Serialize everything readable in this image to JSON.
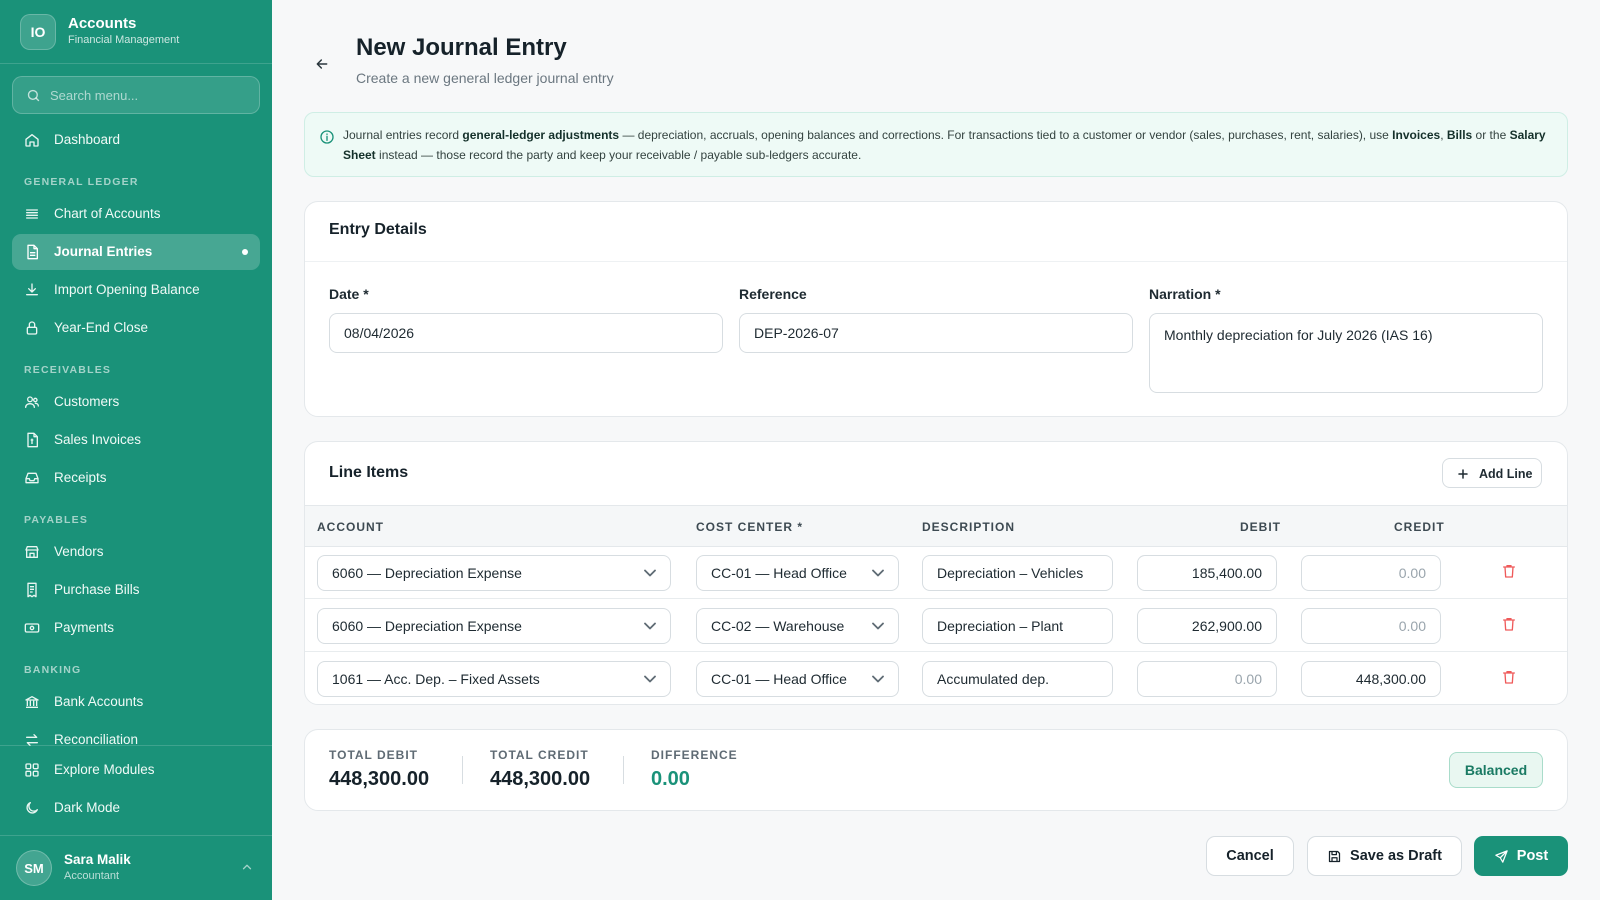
{
  "sidebar": {
    "logo_initials": "IO",
    "app_title": "Accounts",
    "app_subtitle": "Financial Management",
    "search_placeholder": "Search menu...",
    "dashboard": "Dashboard",
    "sections": {
      "general_ledger": "GENERAL LEDGER",
      "receivables": "RECEIVABLES",
      "payables": "PAYABLES",
      "banking": "BANKING"
    },
    "items": {
      "chart_of_accounts": "Chart of Accounts",
      "journal_entries": "Journal Entries",
      "import_opening_balance": "Import Opening Balance",
      "year_end_close": "Year-End Close",
      "customers": "Customers",
      "sales_invoices": "Sales Invoices",
      "receipts": "Receipts",
      "vendors": "Vendors",
      "purchase_bills": "Purchase Bills",
      "payments": "Payments",
      "bank_accounts": "Bank Accounts",
      "reconciliation": "Reconciliation"
    },
    "explore_modules": "Explore Modules",
    "dark_mode": "Dark Mode",
    "user": {
      "initials": "SM",
      "name": "Sara Malik",
      "role": "Accountant"
    }
  },
  "header": {
    "title": "New Journal Entry",
    "subtitle": "Create a new general ledger journal entry"
  },
  "info": {
    "t1": "Journal entries record ",
    "b1": "general-ledger adjustments",
    "t2": " — depreciation, accruals, opening balances and corrections. For transactions tied to a customer or vendor (sales, purchases, rent, salaries), use ",
    "b2": "Invoices",
    "t3": ", ",
    "b3": "Bills",
    "t4": " or the ",
    "b4": "Salary Sheet",
    "t5": " instead — those record the party and keep your receivable / payable sub-ledgers accurate."
  },
  "entry": {
    "title": "Entry Details",
    "date_label": "Date *",
    "date_value": "08/04/2026",
    "reference_label": "Reference",
    "reference_value": "DEP-2026-07",
    "narration_label": "Narration *",
    "narration_value": "Monthly depreciation for July 2026 (IAS 16)"
  },
  "lines": {
    "title": "Line Items",
    "add_line": "Add Line",
    "headers": {
      "account": "ACCOUNT",
      "cost_center": "COST CENTER *",
      "description": "DESCRIPTION",
      "debit": "DEBIT",
      "credit": "CREDIT"
    },
    "rows": [
      {
        "account": "6060 — Depreciation Expense",
        "cost_center": "CC-01 — Head Office",
        "description": "Depreciation – Vehicles",
        "debit": "185,400.00",
        "credit": "0.00"
      },
      {
        "account": "6060 — Depreciation Expense",
        "cost_center": "CC-02 — Warehouse",
        "description": "Depreciation – Plant",
        "debit": "262,900.00",
        "credit": "0.00"
      },
      {
        "account": "1061 — Acc. Dep. – Fixed Assets",
        "cost_center": "CC-01 — Head Office",
        "description": "Accumulated dep.",
        "debit": "0.00",
        "credit": "448,300.00"
      }
    ]
  },
  "totals": {
    "debit_label": "TOTAL DEBIT",
    "debit_value": "448,300.00",
    "credit_label": "TOTAL CREDIT",
    "credit_value": "448,300.00",
    "difference_label": "DIFFERENCE",
    "difference_value": "0.00",
    "status": "Balanced"
  },
  "actions": {
    "cancel": "Cancel",
    "save_draft": "Save as Draft",
    "post": "Post"
  },
  "colors": {
    "sidebar": "#1a9279",
    "accent": "#1a9279",
    "danger": "#ef5a5a"
  }
}
